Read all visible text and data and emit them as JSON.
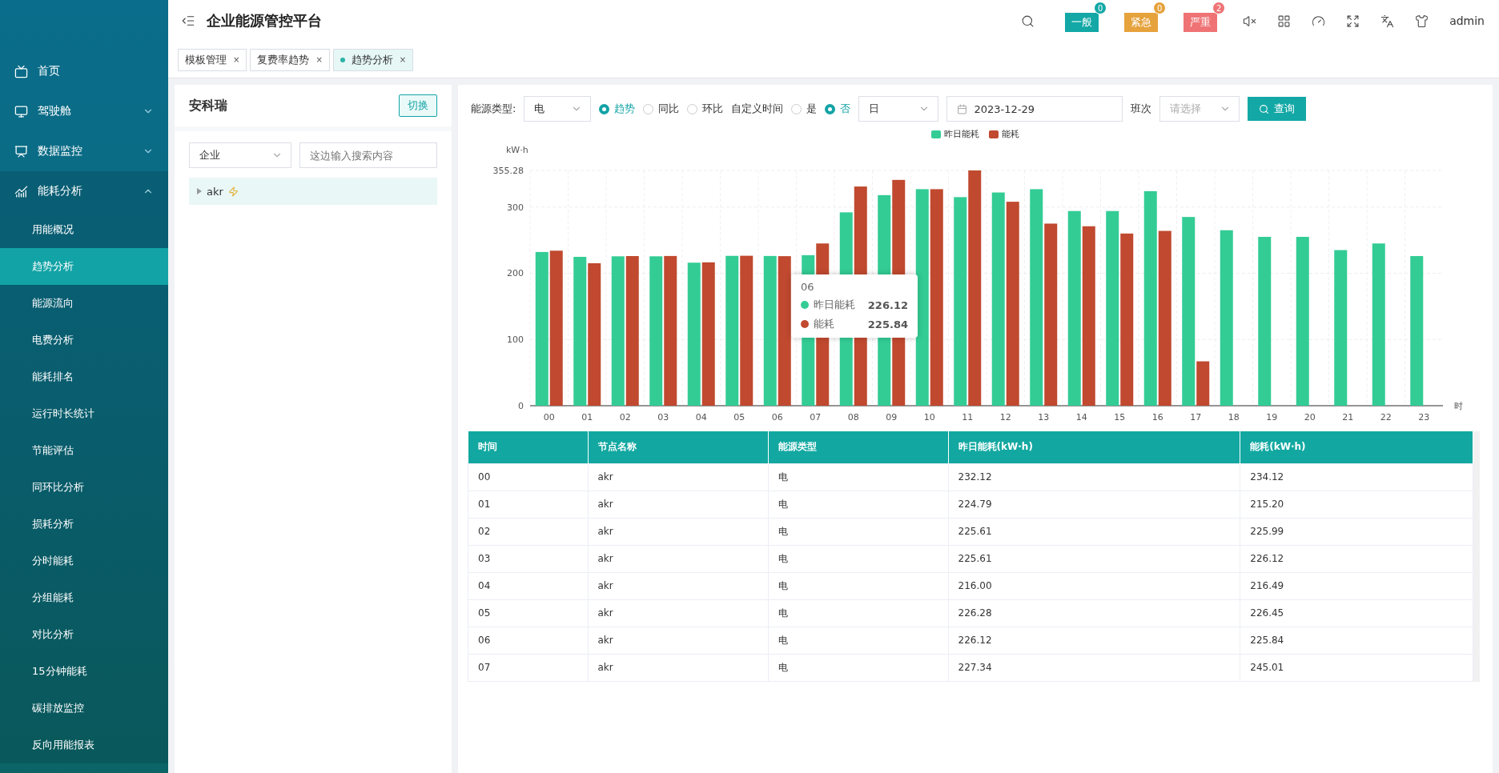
{
  "header": {
    "title": "企业能源管控平台",
    "alerts": [
      {
        "label": "一般",
        "count": "0",
        "kind": "normal"
      },
      {
        "label": "紧急",
        "count": "0",
        "kind": "urgent"
      },
      {
        "label": "严重",
        "count": "2",
        "kind": "severe"
      }
    ],
    "user": "admin"
  },
  "tabs": [
    {
      "label": "模板管理",
      "close": "×",
      "selected": false
    },
    {
      "label": "复费率趋势",
      "close": "×",
      "selected": false
    },
    {
      "label": "趋势分析",
      "close": "×",
      "selected": true
    }
  ],
  "sidebar": {
    "items": [
      {
        "label": "首页",
        "kind": "link"
      },
      {
        "label": "驾驶舱",
        "kind": "group",
        "expanded": false
      },
      {
        "label": "数据监控",
        "kind": "group",
        "expanded": false
      },
      {
        "label": "能耗分析",
        "kind": "group",
        "expanded": true,
        "children": [
          {
            "label": "用能概况",
            "selected": false
          },
          {
            "label": "趋势分析",
            "selected": true
          },
          {
            "label": "能源流向",
            "selected": false
          },
          {
            "label": "电费分析",
            "selected": false
          },
          {
            "label": "能耗排名",
            "selected": false
          },
          {
            "label": "运行时长统计",
            "selected": false
          },
          {
            "label": "节能评估",
            "selected": false
          },
          {
            "label": "同环比分析",
            "selected": false
          },
          {
            "label": "损耗分析",
            "selected": false
          },
          {
            "label": "分时能耗",
            "selected": false
          },
          {
            "label": "分组能耗",
            "selected": false
          },
          {
            "label": "对比分析",
            "selected": false
          },
          {
            "label": "15分钟能耗",
            "selected": false
          },
          {
            "label": "碳排放监控",
            "selected": false
          },
          {
            "label": "反向用能报表",
            "selected": false
          }
        ]
      }
    ]
  },
  "left_panel": {
    "title": "安科瑞",
    "switch_button": "切换",
    "type_select": "企业",
    "search": {
      "placeholder": "这边输入搜索内容"
    },
    "tree": [
      {
        "label": "akr",
        "selected": true
      }
    ]
  },
  "filters": {
    "energy_label": "能源类型:",
    "energy_value": "电",
    "modes": [
      {
        "label": "趋势",
        "selected": true
      },
      {
        "label": "同比",
        "selected": false
      },
      {
        "label": "环比",
        "selected": false
      }
    ],
    "custom_label": "自定义时间",
    "custom": [
      {
        "label": "是",
        "selected": false
      },
      {
        "label": "否",
        "selected": true
      }
    ],
    "period": "日",
    "date": "2023-12-29",
    "shift_label": "班次",
    "shift": {
      "placeholder": "请选择"
    },
    "query_button": "查询"
  },
  "chart": {
    "tooltip": {
      "title": "06",
      "rows": [
        {
          "name": "昨日能耗",
          "value": "226.12",
          "color": "#33cc95"
        },
        {
          "name": "能耗",
          "value": "225.84",
          "color": "#c0492f"
        }
      ]
    },
    "chart_data": {
      "type": "bar",
      "ylabel": "kW·h",
      "xlabel": "时",
      "categories": [
        "00",
        "01",
        "02",
        "03",
        "04",
        "05",
        "06",
        "07",
        "08",
        "09",
        "10",
        "11",
        "12",
        "13",
        "14",
        "15",
        "16",
        "17",
        "18",
        "19",
        "20",
        "21",
        "22",
        "23"
      ],
      "series": [
        {
          "name": "昨日能耗",
          "color": "#33cc95",
          "values": [
            232.12,
            224.79,
            225.61,
            225.61,
            216.0,
            226.28,
            226.12,
            227.34,
            292,
            318,
            327,
            315,
            322,
            327,
            294,
            294,
            324,
            285,
            265,
            255,
            255,
            235,
            245,
            226
          ]
        },
        {
          "name": "能耗",
          "color": "#c0492f",
          "values": [
            234.12,
            215.2,
            225.99,
            226.12,
            216.49,
            226.45,
            225.84,
            245.01,
            331,
            341,
            327,
            355.28,
            308,
            275,
            271,
            260,
            264,
            67,
            null,
            null,
            null,
            null,
            null,
            null
          ]
        }
      ],
      "ylim": [
        0,
        355.28
      ],
      "grid": true,
      "yticks": [
        0,
        100,
        200,
        300,
        355.28
      ]
    }
  },
  "table": {
    "columns": [
      "时间",
      "节点名称",
      "能源类型",
      "昨日能耗(kW·h)",
      "能耗(kW·h)"
    ],
    "rows": [
      [
        "00",
        "akr",
        "电",
        "232.12",
        "234.12"
      ],
      [
        "01",
        "akr",
        "电",
        "224.79",
        "215.20"
      ],
      [
        "02",
        "akr",
        "电",
        "225.61",
        "225.99"
      ],
      [
        "03",
        "akr",
        "电",
        "225.61",
        "226.12"
      ],
      [
        "04",
        "akr",
        "电",
        "216.00",
        "216.49"
      ],
      [
        "05",
        "akr",
        "电",
        "226.28",
        "226.45"
      ],
      [
        "06",
        "akr",
        "电",
        "226.12",
        "225.84"
      ],
      [
        "07",
        "akr",
        "电",
        "227.34",
        "245.01"
      ]
    ]
  }
}
